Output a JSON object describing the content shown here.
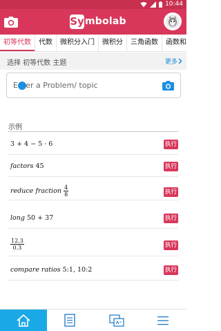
{
  "status_bar": {
    "time": "10:44"
  },
  "app_bar": {
    "logo_letter": "Sy",
    "logo_rest": "mbolab"
  },
  "tabs": [
    {
      "label": "初等代数",
      "active": true
    },
    {
      "label": "代数",
      "active": false
    },
    {
      "label": "微积分入门",
      "active": false
    },
    {
      "label": "微积分",
      "active": false
    },
    {
      "label": "三角函数",
      "active": false
    },
    {
      "label": "函数和",
      "active": false
    }
  ],
  "topic_row": {
    "label": "选择 初等代数 主题",
    "more_label": "更多"
  },
  "problem_input": {
    "placeholder": "Enter a Problem/ topic"
  },
  "examples": {
    "title": "示例",
    "run_label": "执行",
    "items": [
      {
        "text": "3 + 4 − 5 · 6"
      },
      {
        "word": "factors",
        "text": "45"
      },
      {
        "word": "reduce fraction",
        "numerator": "4",
        "denominator": "8"
      },
      {
        "word": "long",
        "text": "50 + 37"
      },
      {
        "numerator": "12.3",
        "denominator": "0.3"
      },
      {
        "word": "compare ratios",
        "text": "5:1, 10:2"
      }
    ]
  },
  "bottom_nav": [
    {
      "icon": "home-icon",
      "active": true
    },
    {
      "icon": "notebook-icon",
      "active": false
    },
    {
      "icon": "practice-icon",
      "active": false
    },
    {
      "icon": "menu-icon",
      "active": false
    }
  ],
  "colors": {
    "brand": "#d8375b",
    "status_bar": "#c8304f",
    "accent_blue": "#1ba8e6",
    "link": "#1a8fd8"
  }
}
